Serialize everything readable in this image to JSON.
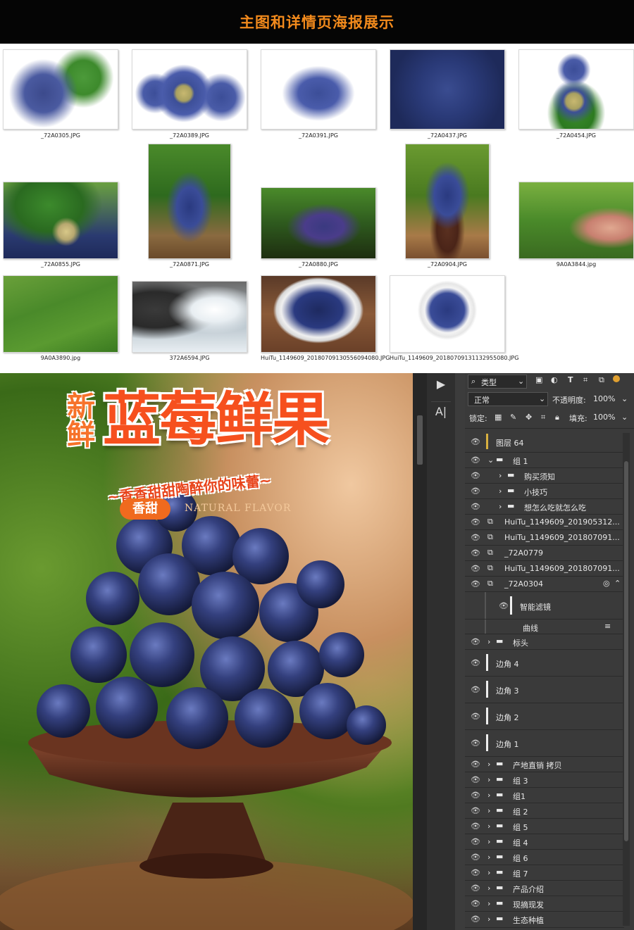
{
  "header": {
    "title": "主图和详情页海报展示"
  },
  "gallery": {
    "thumbs": [
      {
        "caption": "_72A0305.JPG"
      },
      {
        "caption": "_72A0389.JPG"
      },
      {
        "caption": "_72A0391.JPG"
      },
      {
        "caption": "_72A0437.JPG"
      },
      {
        "caption": "_72A0454.JPG"
      },
      {
        "caption": "_72A0855.JPG"
      },
      {
        "caption": "_72A0871.JPG"
      },
      {
        "caption": "_72A0880.JPG"
      },
      {
        "caption": "_72A0904.JPG"
      },
      {
        "caption": "9A0A3844.jpg"
      },
      {
        "caption": "9A0A3890.jpg"
      },
      {
        "caption": "372A6594.JPG"
      },
      {
        "caption": "HuiTu_1149609_20180709130556094080.JPG"
      },
      {
        "caption": "HuiTu_1149609_20180709131132955080.JPG"
      }
    ]
  },
  "poster": {
    "small_title": "新鲜",
    "big_title": "蓝莓鲜果",
    "slogan": "~香香甜甜陶醉你的味蕾~",
    "badge": "香甜",
    "english": "NATURAL FLAVOR"
  },
  "ps": {
    "filter_kind": "类型",
    "blend_mode": "正常",
    "opacity_label": "不透明度:",
    "opacity_value": "100%",
    "lock_label": "锁定:",
    "fill_label": "填充:",
    "fill_value": "100%",
    "layers": [
      {
        "name": "图层 64"
      },
      {
        "name": "组 1"
      },
      {
        "name": "购买须知"
      },
      {
        "name": "小技巧"
      },
      {
        "name": "想怎么吃就怎么吃"
      },
      {
        "name": "HuiTu_1149609_201905312..."
      },
      {
        "name": "HuiTu_1149609_201807091..."
      },
      {
        "name": "_72A0779"
      },
      {
        "name": "HuiTu_1149609_201807091..."
      },
      {
        "name": "_72A0304"
      },
      {
        "name": "智能滤镜"
      },
      {
        "name": "曲线"
      },
      {
        "name": "标头"
      },
      {
        "name": "边角 4"
      },
      {
        "name": "边角 3"
      },
      {
        "name": "边角 2"
      },
      {
        "name": "边角 1"
      },
      {
        "name": "产地直销 拷贝"
      },
      {
        "name": "组 3"
      },
      {
        "name": "组1"
      },
      {
        "name": "组 2"
      },
      {
        "name": "组 5"
      },
      {
        "name": "组 4"
      },
      {
        "name": "组 6"
      },
      {
        "name": "组 7"
      },
      {
        "name": "产品介绍"
      },
      {
        "name": "现摘现发"
      },
      {
        "name": "生态种植"
      }
    ]
  }
}
